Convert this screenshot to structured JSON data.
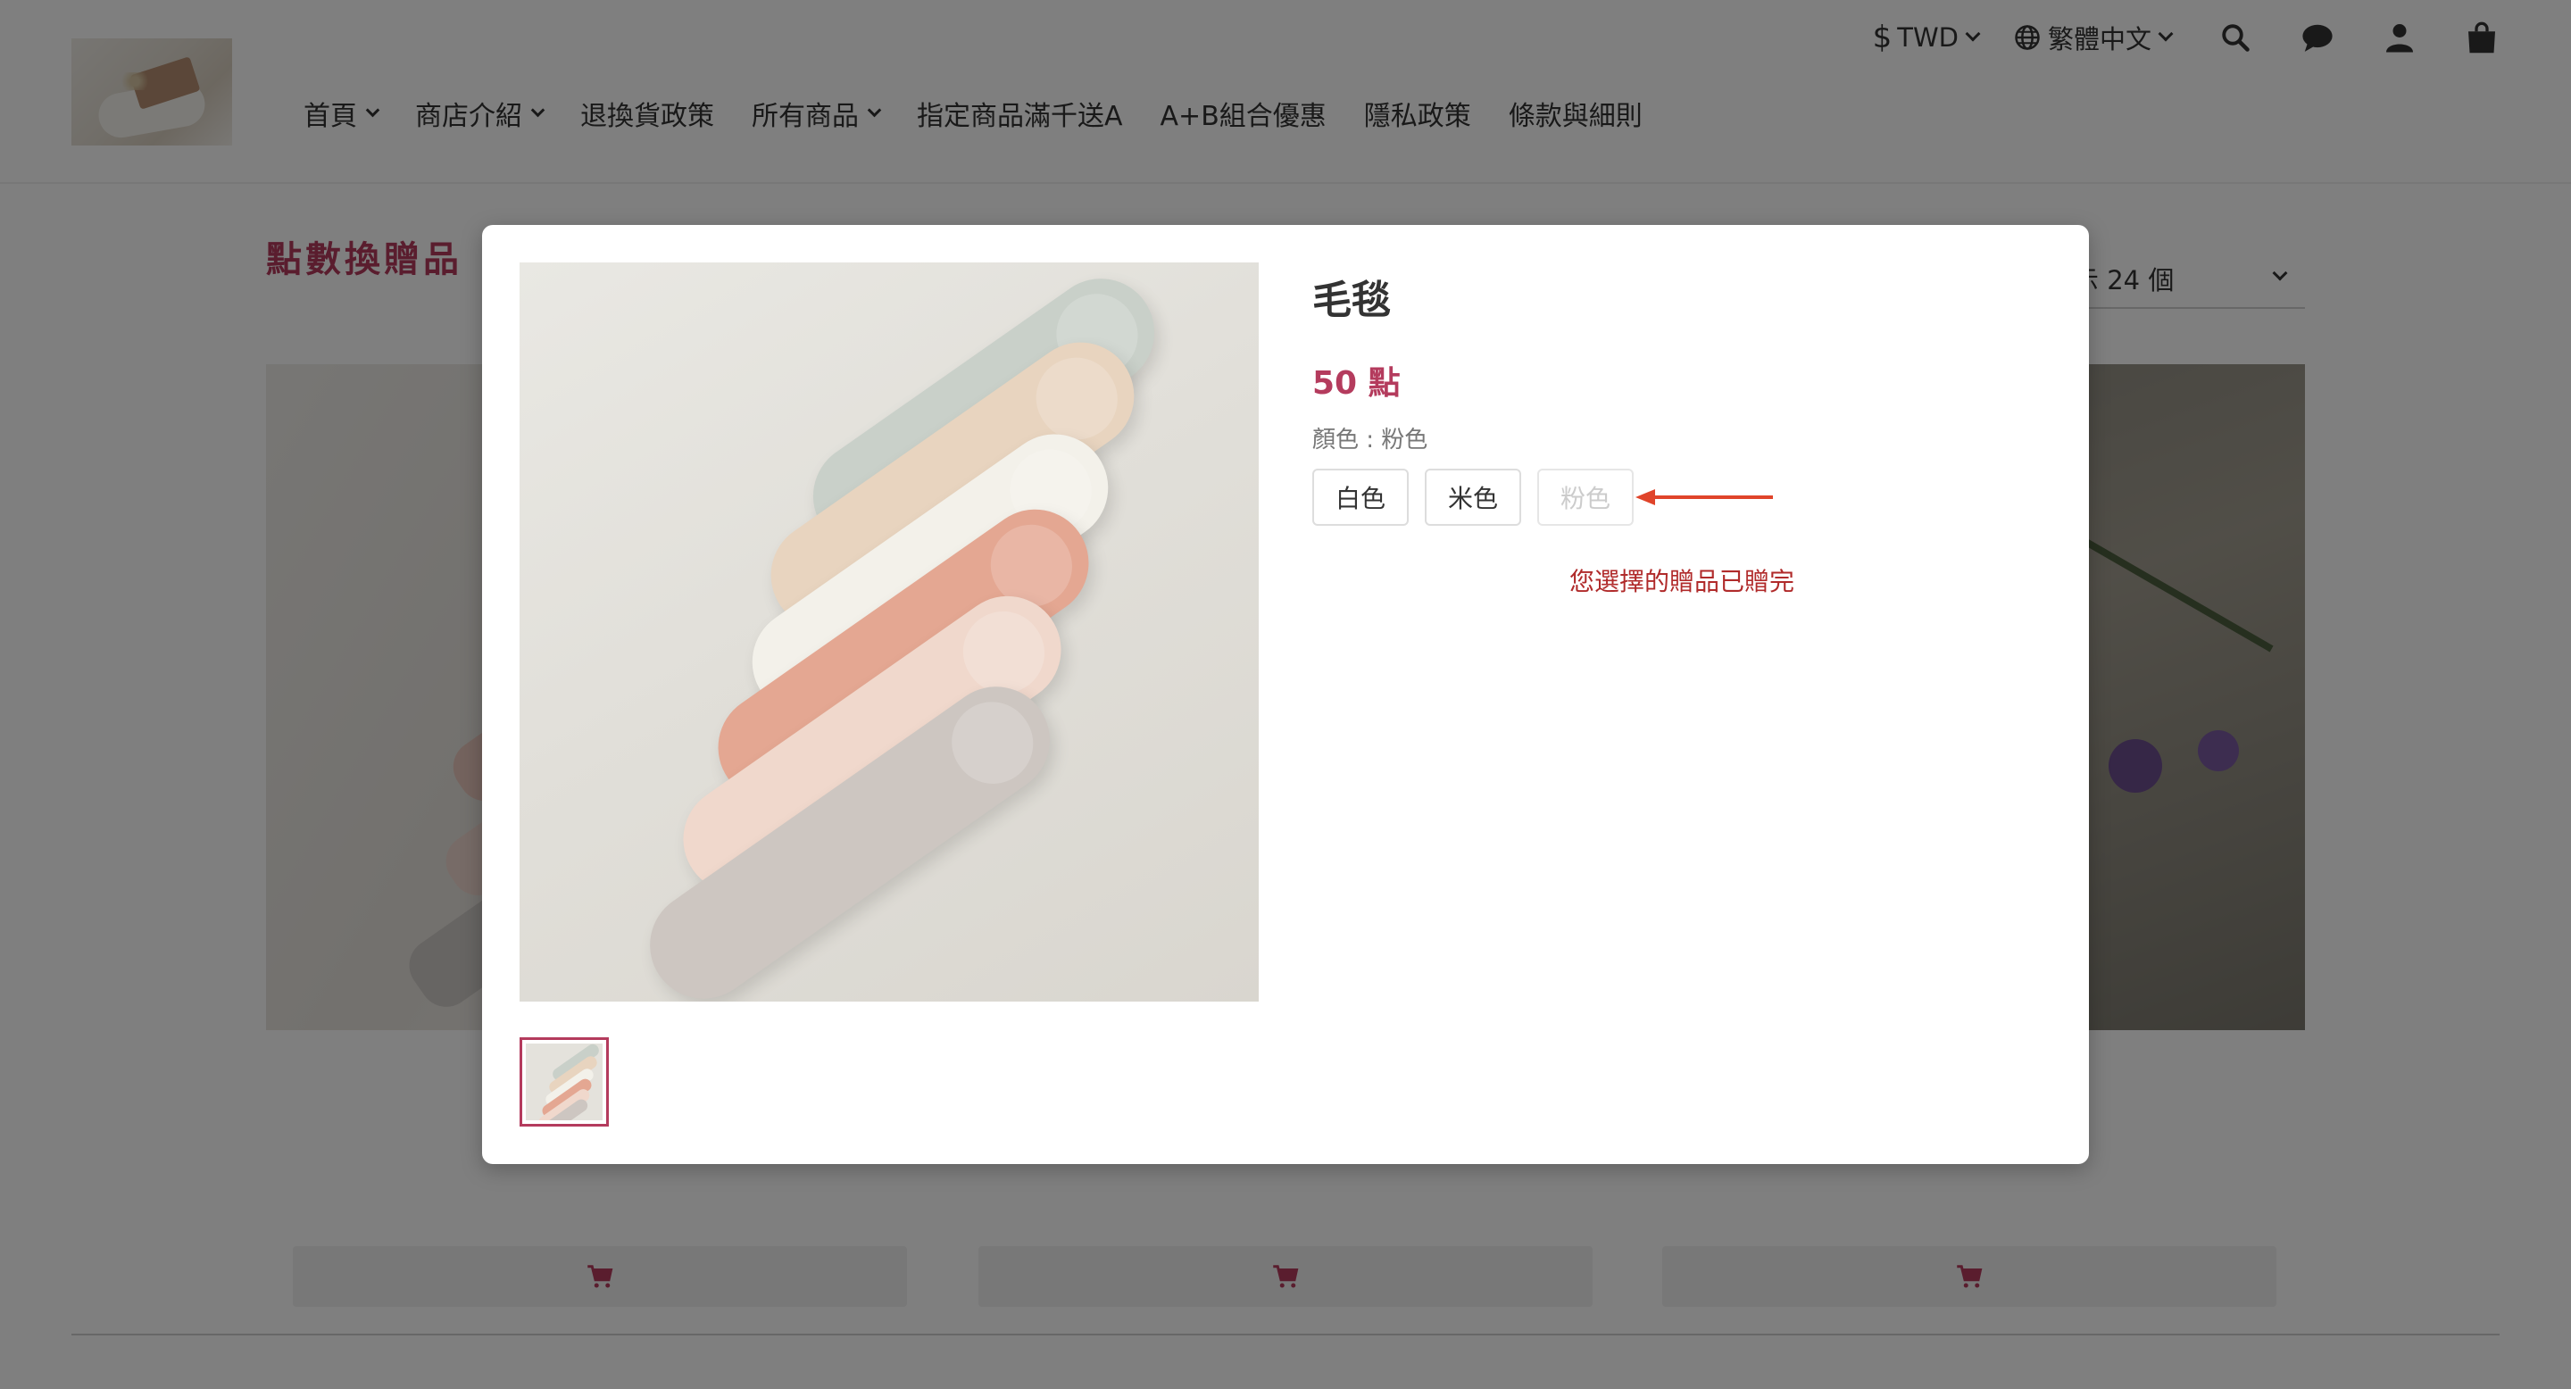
{
  "topbar": {
    "currency_symbol": "$",
    "currency": "TWD",
    "language": "繁體中文",
    "icons": [
      "search-icon",
      "chat-icon",
      "user-icon",
      "shopping-bag-icon"
    ]
  },
  "nav": {
    "items": [
      {
        "label": "首頁",
        "dropdown": true
      },
      {
        "label": "商店介紹",
        "dropdown": true
      },
      {
        "label": "退換貨政策",
        "dropdown": false
      },
      {
        "label": "所有商品",
        "dropdown": true
      },
      {
        "label": "指定商品滿千送A",
        "dropdown": false
      },
      {
        "label": "A+B組合優惠",
        "dropdown": false
      },
      {
        "label": "隱私政策",
        "dropdown": false
      },
      {
        "label": "條款與細則",
        "dropdown": false
      }
    ]
  },
  "page": {
    "title": "點數換贈品",
    "sort_label": "示 24 個"
  },
  "modal": {
    "product_name": "毛毯",
    "price": "50 點",
    "variant_label": "顏色 : 粉色",
    "variants": [
      {
        "label": "白色",
        "disabled": false
      },
      {
        "label": "米色",
        "disabled": false
      },
      {
        "label": "粉色",
        "disabled": true
      }
    ],
    "sold_out_message": "您選擇的贈品已贈完"
  },
  "colors": {
    "brand": "#b43b5d",
    "annotation_arrow": "#e0442a",
    "error_text": "#b02a2a"
  }
}
